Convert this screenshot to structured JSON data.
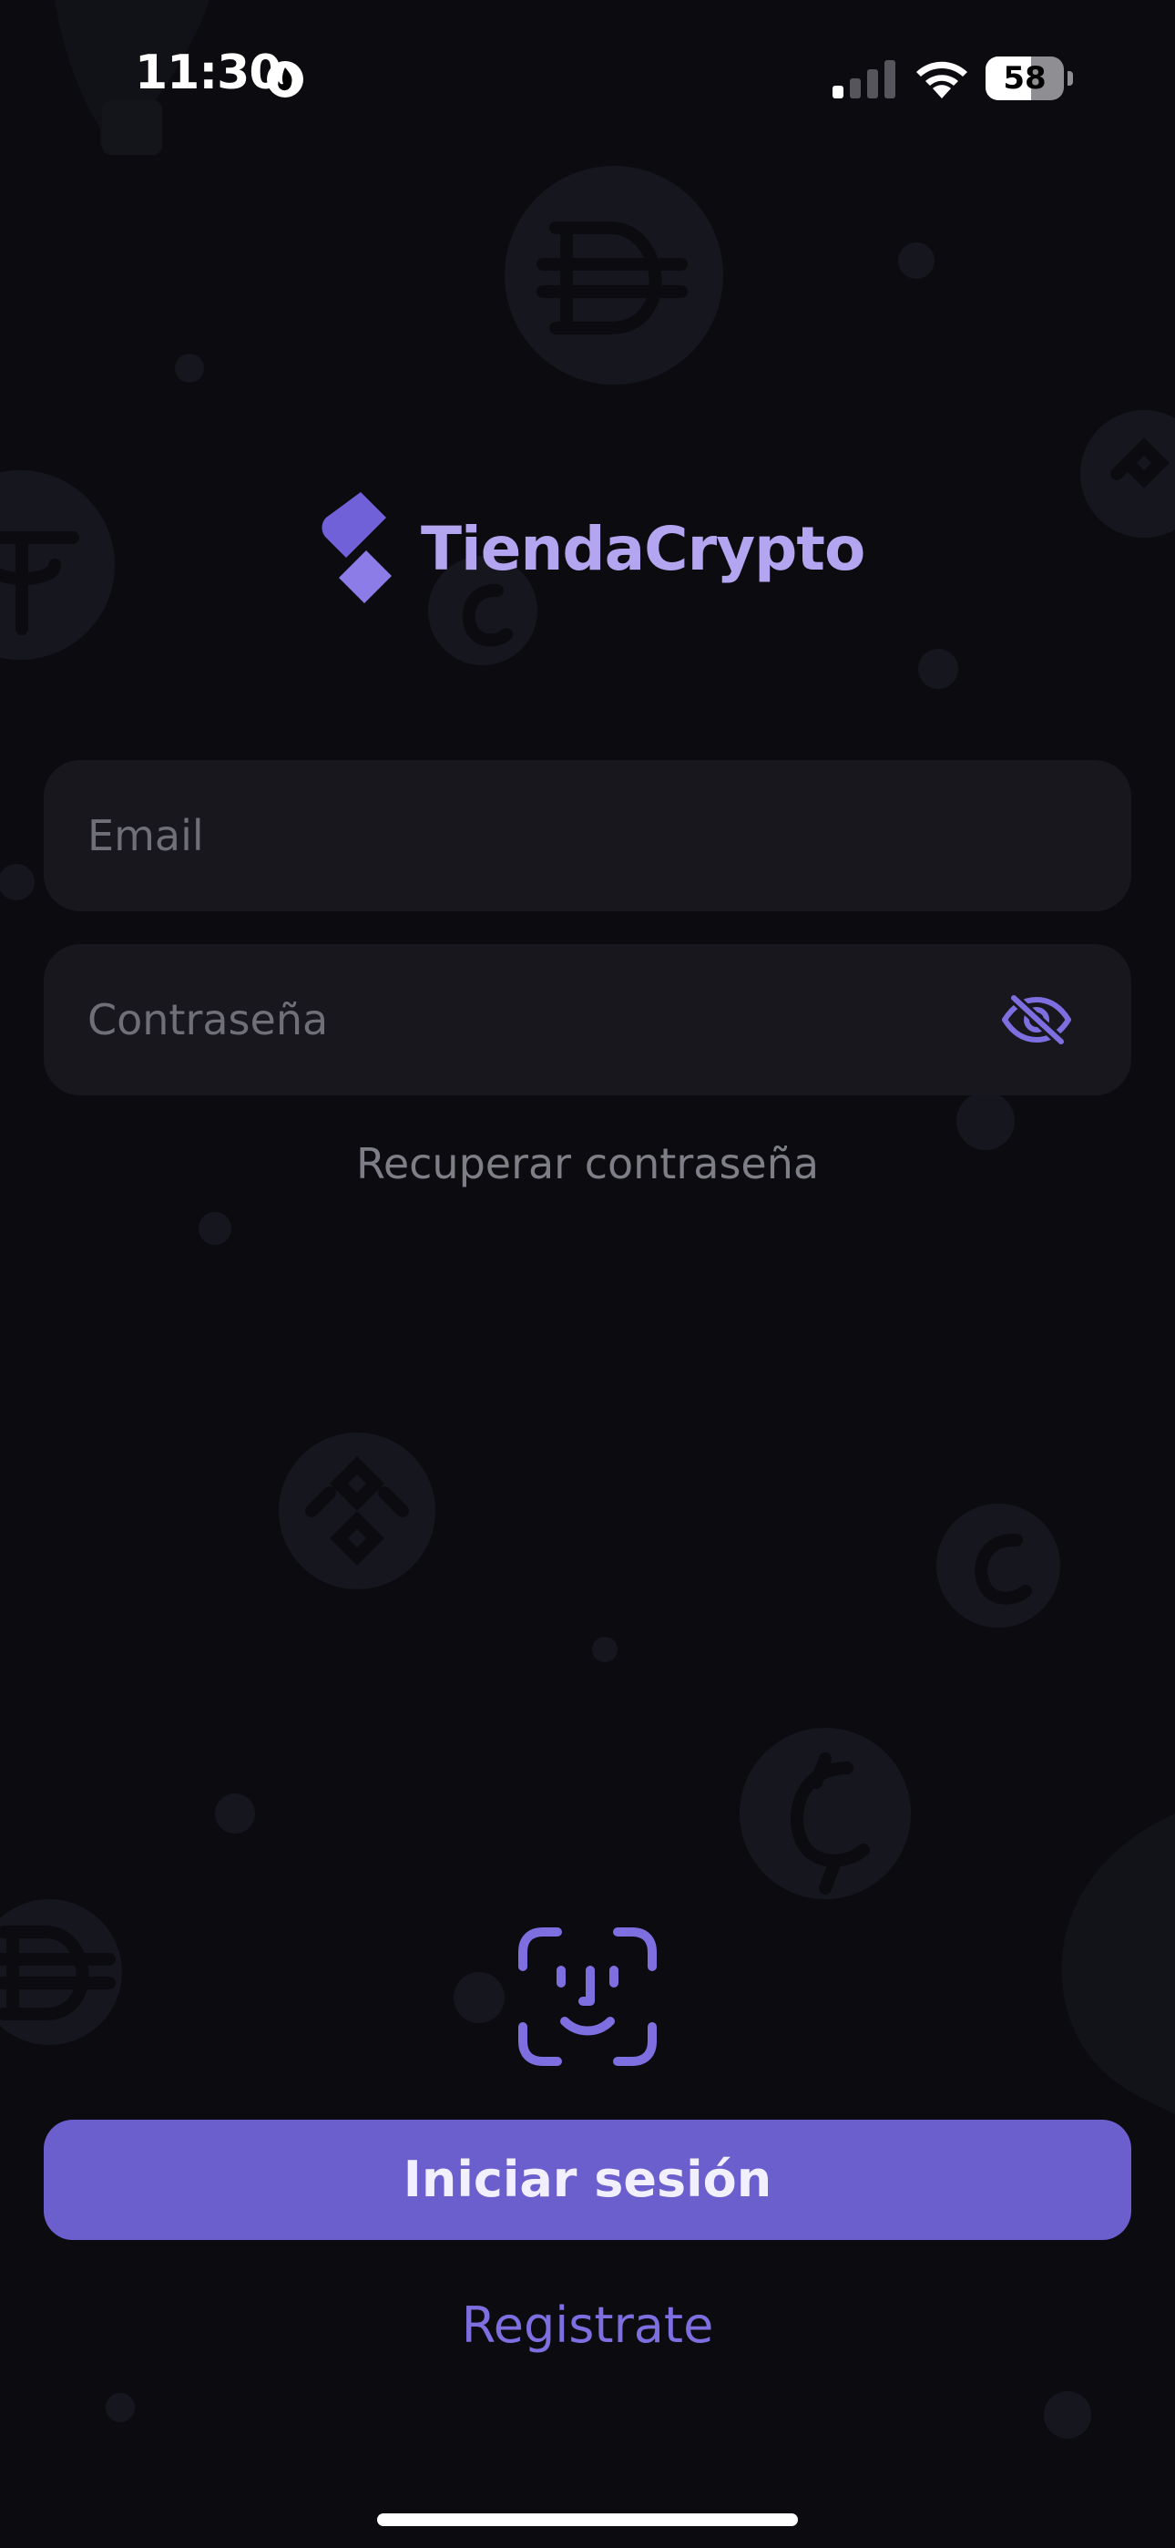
{
  "status_bar": {
    "time": "11:30",
    "battery": "58",
    "battery_level": 0.58,
    "icons": [
      "flame-icon",
      "signal-icon",
      "wifi-icon",
      "battery-icon"
    ]
  },
  "brand": {
    "name": "TiendaCrypto",
    "icon": "tiendacrypto-logo-icon",
    "text_color": "#b4a5f0"
  },
  "login_form": {
    "email_placeholder": "Email",
    "email_value": "",
    "password_placeholder": "Contraseña",
    "password_value": "",
    "password_toggle_icon": "eye-slash-icon",
    "recover_label": "Recuperar contraseña",
    "faceid_icon": "face-id-icon",
    "submit_label": "Iniciar sesión",
    "register_label": "Registrate"
  },
  "colors": {
    "background": "#0b0b10",
    "field_background": "#17171d",
    "accent": "#6b5fcd",
    "accent_light": "#7d6fdf",
    "muted_text": "#7e7e86"
  }
}
